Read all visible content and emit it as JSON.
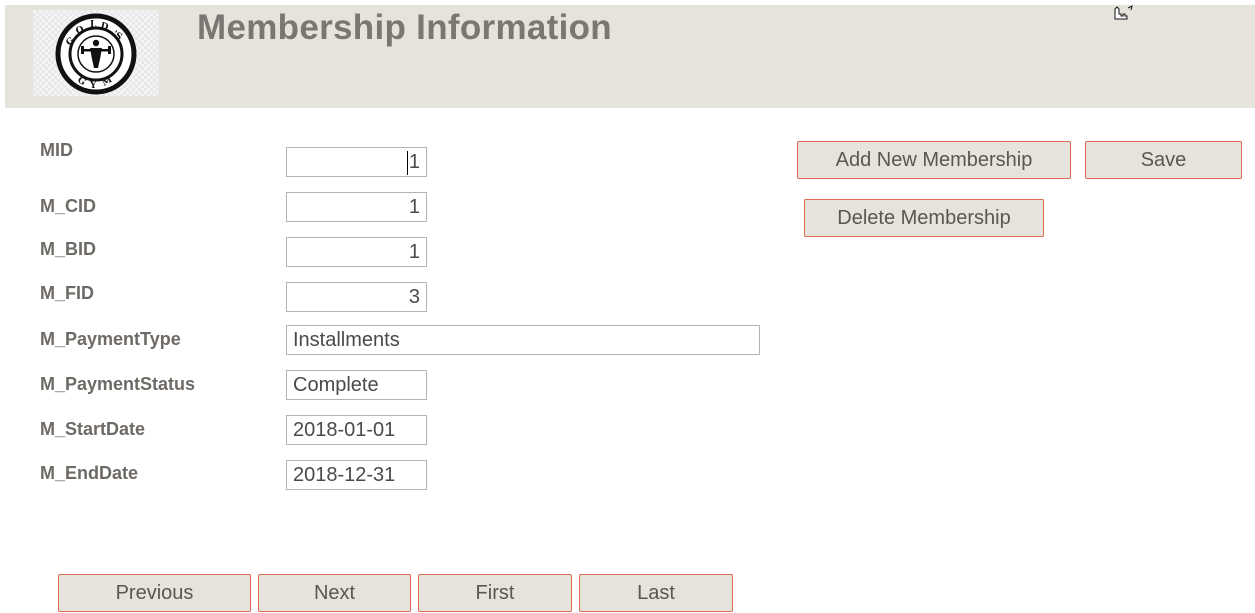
{
  "header": {
    "title": "Membership Information",
    "logo": "golds-gym-logo"
  },
  "fields": [
    {
      "label": "MID",
      "value": "1"
    },
    {
      "label": "M_CID",
      "value": "1"
    },
    {
      "label": "M_BID",
      "value": "1"
    },
    {
      "label": "M_FID",
      "value": "3"
    },
    {
      "label": "M_PaymentType",
      "value": "Installments"
    },
    {
      "label": "M_PaymentStatus",
      "value": "Complete"
    },
    {
      "label": "M_StartDate",
      "value": "2018-01-01"
    },
    {
      "label": "M_EndDate",
      "value": "2018-12-31"
    }
  ],
  "actions": {
    "add_label": "Add New Membership",
    "save_label": "Save",
    "delete_label": "Delete Membership"
  },
  "nav": {
    "previous_label": "Previous",
    "next_label": "Next",
    "first_label": "First",
    "last_label": "Last"
  },
  "colors": {
    "header_bg": "#e6e3dd",
    "title": "#7a7672",
    "label": "#6e6a66",
    "button_border": "#e06a52",
    "button_bg": "#e6e3dd"
  }
}
